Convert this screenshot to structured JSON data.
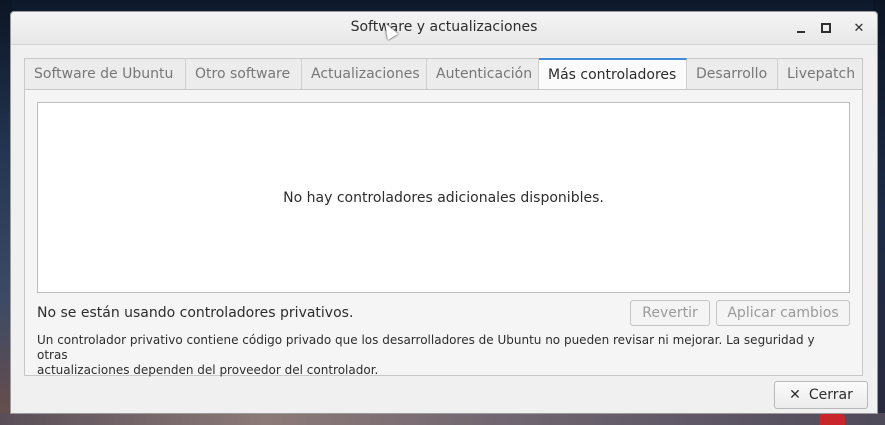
{
  "window": {
    "title": "Software y actualizaciones"
  },
  "tabs": [
    {
      "label": "Software de Ubuntu"
    },
    {
      "label": "Otro software"
    },
    {
      "label": "Actualizaciones"
    },
    {
      "label": "Autenticación"
    },
    {
      "label": "Más controladores"
    },
    {
      "label": "Desarrollo"
    },
    {
      "label": "Livepatch"
    }
  ],
  "active_tab": "Más controladores",
  "drivers_panel": {
    "empty_message": "No hay controladores adicionales disponibles."
  },
  "status_text": "No se están usando controladores privativos.",
  "buttons": {
    "revert_label": "Revertir",
    "apply_label": "Aplicar cambios",
    "close_label": "Cerrar"
  },
  "note": {
    "line1": "Un controlador privativo contiene código privado que los desarrolladores de Ubuntu no pueden revisar ni mejorar. La seguridad y otras",
    "line2": "actualizaciones dependen del proveedor del controlador."
  },
  "icons": {
    "minimize": "minimize-icon",
    "maximize": "maximize-icon",
    "close": "close-icon",
    "close_button": "close-x-icon"
  },
  "colors": {
    "active_tab_accent": "#3d8bd9",
    "window_bg": "#f0f0f0"
  }
}
